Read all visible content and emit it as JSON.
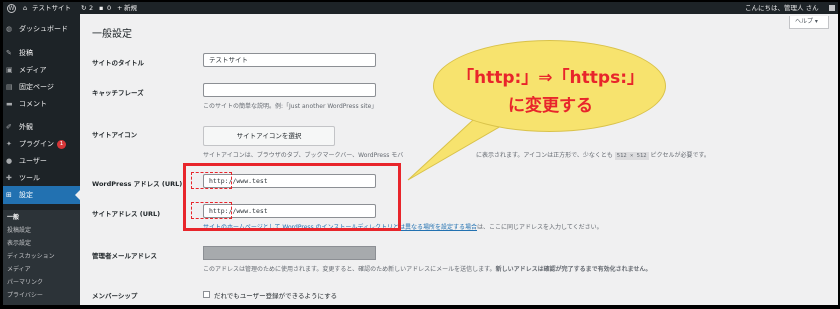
{
  "adminbar": {
    "site_name": "テストサイト",
    "updates_count": "2",
    "comments_count": "0",
    "new_label": "新規",
    "greeting": "こんにちは、管理人 さん"
  },
  "sidebar": {
    "items": [
      {
        "label": "ダッシュボード",
        "icon": "dashboard-icon",
        "glyph": "◍"
      },
      {
        "label": "投稿",
        "icon": "pin-icon",
        "glyph": "✎"
      },
      {
        "label": "メディア",
        "icon": "media-icon",
        "glyph": "▣"
      },
      {
        "label": "固定ページ",
        "icon": "page-icon",
        "glyph": "▤"
      },
      {
        "label": "コメント",
        "icon": "comment-icon",
        "glyph": "▬"
      },
      {
        "label": "外観",
        "icon": "brush-icon",
        "glyph": "✐"
      },
      {
        "label": "プラグイン",
        "icon": "plugin-icon",
        "glyph": "✦",
        "badge": "1"
      },
      {
        "label": "ユーザー",
        "icon": "users-icon",
        "glyph": "●"
      },
      {
        "label": "ツール",
        "icon": "wrench-icon",
        "glyph": "✚"
      },
      {
        "label": "設定",
        "icon": "settings-icon",
        "glyph": "⊞"
      }
    ],
    "submenu": [
      "一般",
      "投稿設定",
      "表示設定",
      "ディスカッション",
      "メディア",
      "パーマリンク",
      "プライバシー"
    ]
  },
  "help_tab": "ヘルプ ▾",
  "page_title": "一般設定",
  "fields": {
    "site_title_label": "サイトのタイトル",
    "site_title_value": "テストサイト",
    "tagline_label": "キャッチフレーズ",
    "tagline_value": "",
    "tagline_desc": "このサイトの簡単な説明。例:「Just another WordPress site」",
    "site_icon_label": "サイトアイコン",
    "site_icon_button": "サイトアイコンを選択",
    "site_icon_desc_1": "サイトアイコンは、ブラウザのタブ、ブックマークバー、WordPress モバ",
    "site_icon_desc_2": "に表示されます。アイコンは正方形で、少なくとも",
    "site_icon_size": "512 × 512",
    "site_icon_desc_3": "ピクセルが必要です。",
    "wp_address_label": "WordPress アドレス (URL)",
    "wp_address_value": "http://www.test",
    "site_address_label": "サイトアドレス (URL)",
    "site_address_value": "http://www.test",
    "site_address_desc_link": "サイトのホームページとして WordPress のインストールディレクトリとは異なる場所を設定する場合",
    "site_address_desc_rest": "は、ここに同じアドレスを入力してください。",
    "admin_email_label": "管理者メールアドレス",
    "admin_email_desc": "このアドレスは管理のために使用されます。変更すると、確認のため新しいアドレスにメールを送信します。",
    "admin_email_desc_bold": "新しいアドレスは確認が完了するまで有効化されません。",
    "membership_label": "メンバーシップ",
    "membership_checkbox_label": "だれでもユーザー登録ができるようにする"
  },
  "callout": {
    "line1": "「http:」⇒「https:」",
    "line2": "に変更する"
  },
  "colors": {
    "accent": "#2271b1",
    "highlight_red": "#e8252b",
    "bubble_yellow": "#f7e36e"
  }
}
